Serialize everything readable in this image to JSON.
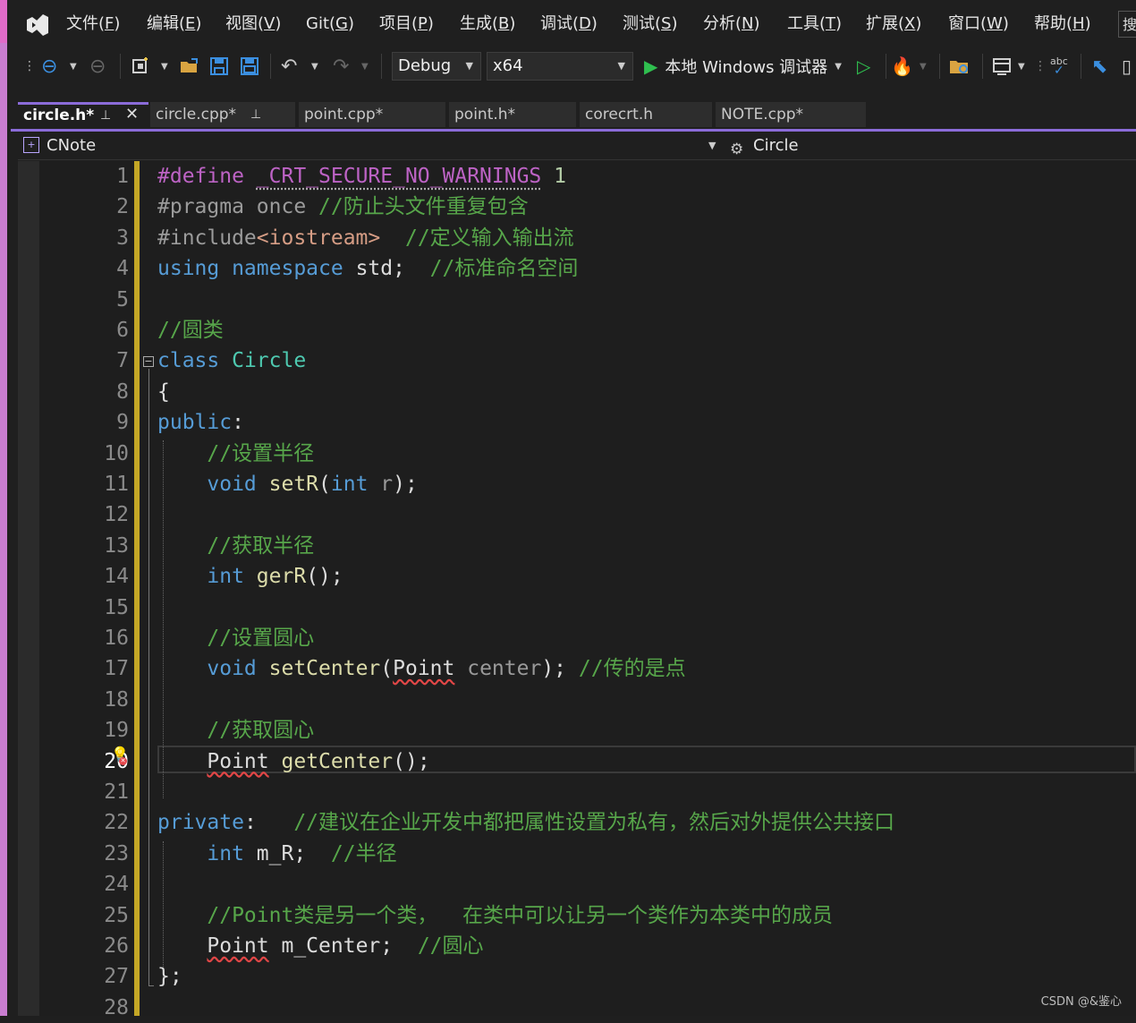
{
  "menu": {
    "items": [
      {
        "label": "文件(",
        "key": "F",
        "end": ")"
      },
      {
        "label": "编辑(",
        "key": "E",
        "end": ")"
      },
      {
        "label": "视图(",
        "key": "V",
        "end": ")"
      },
      {
        "label": "Git(",
        "key": "G",
        "end": ")"
      },
      {
        "label": "项目(",
        "key": "P",
        "end": ")"
      },
      {
        "label": "生成(",
        "key": "B",
        "end": ")"
      },
      {
        "label": "调试(",
        "key": "D",
        "end": ")"
      },
      {
        "label": "测试(",
        "key": "S",
        "end": ")"
      },
      {
        "label": "分析(",
        "key": "N",
        "end": ")"
      },
      {
        "label": "工具(",
        "key": "T",
        "end": ")"
      },
      {
        "label": "扩展(",
        "key": "X",
        "end": ")"
      },
      {
        "label": "窗口(",
        "key": "W",
        "end": ")"
      },
      {
        "label": "帮助(",
        "key": "H",
        "end": ")"
      }
    ],
    "search_stub": "搜"
  },
  "toolbar": {
    "config": "Debug",
    "platform": "x64",
    "run_label": "本地 Windows 调试器",
    "spell_label": "abc"
  },
  "tabs": [
    {
      "label": "circle.h*",
      "active": true
    },
    {
      "label": "circle.cpp*",
      "active": false
    },
    {
      "label": "point.cpp*",
      "active": false
    },
    {
      "label": "point.h*",
      "active": false
    },
    {
      "label": "corecrt.h",
      "active": false
    },
    {
      "label": "NOTE.cpp*",
      "active": false
    }
  ],
  "nav": {
    "project": "CNote",
    "scope": "Circle"
  },
  "editor": {
    "line_numbers": [
      "1",
      "2",
      "3",
      "4",
      "5",
      "6",
      "7",
      "8",
      "9",
      "10",
      "11",
      "12",
      "13",
      "14",
      "15",
      "16",
      "17",
      "18",
      "19",
      "20",
      "21",
      "22",
      "23",
      "24",
      "25",
      "26",
      "27",
      "28"
    ],
    "current_line": "20",
    "lines": [
      [
        [
          "m",
          "#define"
        ],
        [
          "id",
          " "
        ],
        [
          "m dots",
          "_CRT_SECURE_NO_WARNINGS"
        ],
        [
          "id",
          " "
        ],
        [
          "n",
          "1"
        ]
      ],
      [
        [
          "p",
          "#pragma once "
        ],
        [
          "c",
          "//防止头文件重复包含"
        ]
      ],
      [
        [
          "p",
          "#include"
        ],
        [
          "s",
          "<iostream>"
        ],
        [
          "id",
          "  "
        ],
        [
          "c",
          "//定义输入输出流"
        ]
      ],
      [
        [
          "k",
          "using namespace"
        ],
        [
          "id",
          " std;  "
        ],
        [
          "c",
          "//标准命名空间"
        ]
      ],
      [],
      [
        [
          "c",
          "//圆类"
        ]
      ],
      [
        [
          "k",
          "class"
        ],
        [
          "id",
          " "
        ],
        [
          "t",
          "Circle"
        ]
      ],
      [
        [
          "id",
          "{"
        ]
      ],
      [
        [
          "k",
          "public"
        ],
        [
          "id",
          ":"
        ]
      ],
      [
        [
          "id",
          "    "
        ],
        [
          "c",
          "//设置半径"
        ]
      ],
      [
        [
          "id",
          "    "
        ],
        [
          "k",
          "void"
        ],
        [
          "id",
          " "
        ],
        [
          "f",
          "setR"
        ],
        [
          "id",
          "("
        ],
        [
          "k",
          "int"
        ],
        [
          "id",
          " "
        ],
        [
          "param",
          "r"
        ],
        [
          "id",
          ");"
        ]
      ],
      [],
      [
        [
          "id",
          "    "
        ],
        [
          "c",
          "//获取半径"
        ]
      ],
      [
        [
          "id",
          "    "
        ],
        [
          "k",
          "int"
        ],
        [
          "id",
          " "
        ],
        [
          "f",
          "gerR"
        ],
        [
          "id",
          "();"
        ]
      ],
      [],
      [
        [
          "id",
          "    "
        ],
        [
          "c",
          "//设置圆心"
        ]
      ],
      [
        [
          "id",
          "    "
        ],
        [
          "k",
          "void"
        ],
        [
          "id",
          " "
        ],
        [
          "f",
          "setCenter"
        ],
        [
          "id",
          "("
        ],
        [
          "id squig",
          "Point"
        ],
        [
          "id",
          " "
        ],
        [
          "param",
          "center"
        ],
        [
          "id",
          "); "
        ],
        [
          "c",
          "//传的是点"
        ]
      ],
      [],
      [
        [
          "id",
          "    "
        ],
        [
          "c",
          "//获取圆心"
        ]
      ],
      [
        [
          "id",
          "    "
        ],
        [
          "id squig",
          "Point"
        ],
        [
          "id",
          " "
        ],
        [
          "f",
          "getCenter"
        ],
        [
          "id",
          "();"
        ]
      ],
      [],
      [
        [
          "k",
          "private"
        ],
        [
          "id",
          ":   "
        ],
        [
          "c",
          "//建议在企业开发中都把属性设置为私有，然后对外提供公共接口"
        ]
      ],
      [
        [
          "id",
          "    "
        ],
        [
          "k",
          "int"
        ],
        [
          "id",
          " m_R;  "
        ],
        [
          "c",
          "//半径"
        ]
      ],
      [],
      [
        [
          "id",
          "    "
        ],
        [
          "c",
          "//Point类是另一个类，  在类中可以让另一个类作为本类中的成员"
        ]
      ],
      [
        [
          "id",
          "    "
        ],
        [
          "id squig",
          "Point"
        ],
        [
          "id",
          " m_Center;  "
        ],
        [
          "c",
          "//圆心"
        ]
      ],
      [
        [
          "id",
          "};"
        ]
      ],
      []
    ]
  },
  "watermark": "CSDN @&鉴心",
  "colors": {
    "accent": "#8b6cd9",
    "keyword": "#569cd6",
    "type": "#4ec9b0",
    "comment": "#57a64a",
    "run_green": "#2fbf4f"
  }
}
